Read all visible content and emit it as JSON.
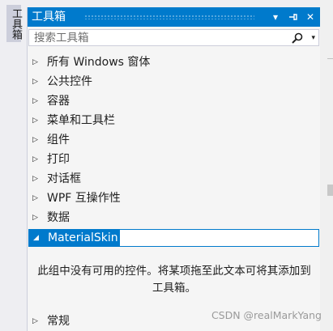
{
  "side_tab": {
    "label": "工具箱"
  },
  "window": {
    "title": "工具箱",
    "buttons": {
      "dropdown": "▾",
      "pin": "⊣",
      "close": "✕"
    }
  },
  "search": {
    "placeholder": "搜索工具箱",
    "icon": "search-icon",
    "dropdown": "▾"
  },
  "groups": [
    {
      "label": "所有 Windows 窗体",
      "expanded": false
    },
    {
      "label": "公共控件",
      "expanded": false
    },
    {
      "label": "容器",
      "expanded": false
    },
    {
      "label": "菜单和工具栏",
      "expanded": false
    },
    {
      "label": "组件",
      "expanded": false
    },
    {
      "label": "打印",
      "expanded": false
    },
    {
      "label": "对话框",
      "expanded": false
    },
    {
      "label": "WPF 互操作性",
      "expanded": false
    },
    {
      "label": "数据",
      "expanded": false
    },
    {
      "label": "MaterialSkin",
      "expanded": true,
      "selected": true
    },
    {
      "label": "常规",
      "expanded": false
    }
  ],
  "arrows": {
    "collapsed": "▷",
    "expanded": "◢"
  },
  "empty_message": "此组中没有可用的控件。将某项拖至此文本可将其添加到工具箱。",
  "watermark": "CSDN @realMarkYang",
  "colors": {
    "accent": "#007acc",
    "panel_bg": "#f5f5f5",
    "text": "#1e1e1e"
  }
}
